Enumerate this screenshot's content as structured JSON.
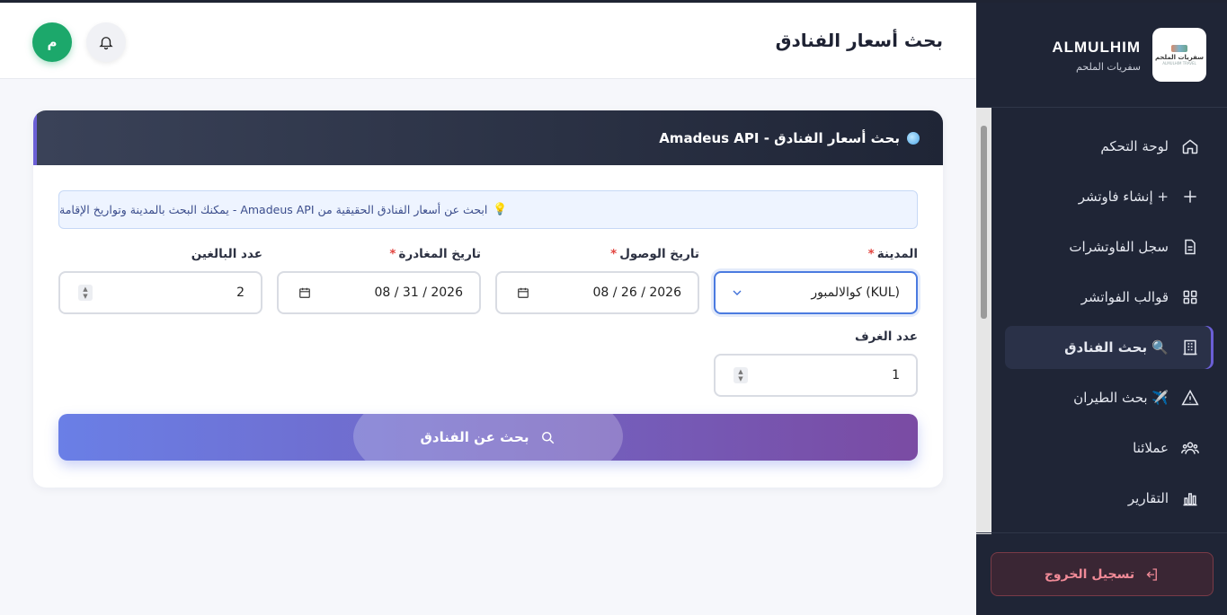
{
  "header": {
    "title": "بحث أسعار الفنادق",
    "avatar_initial": "م"
  },
  "sidebar": {
    "brand_title": "ALMULHIM",
    "brand_subtitle": "سفريات الملحم",
    "logo_text": "سفريات الملحم",
    "logo_subtext": "ALMULHIM TRAVEL",
    "items": [
      {
        "label": "لوحة التحكم",
        "icon": "home-icon"
      },
      {
        "label": "+ إنشاء فاوتشر",
        "icon": "plus-icon"
      },
      {
        "label": "سجل الفاوتشرات",
        "icon": "document-icon"
      },
      {
        "label": "قوالب الفواتشر",
        "icon": "grid-icon"
      },
      {
        "label": "🔍 بحث الفنادق",
        "icon": "building-icon",
        "active": true
      },
      {
        "label": "✈️ بحث الطيران",
        "icon": "warning-triangle-icon"
      },
      {
        "label": "عملائنا",
        "icon": "users-icon"
      },
      {
        "label": "التقارير",
        "icon": "bar-chart-icon"
      }
    ],
    "logout_label": "تسجيل الخروج"
  },
  "card": {
    "title": "بحث أسعار الفنادق - Amadeus API",
    "hint": "ابحث عن أسعار الفنادق الحقيقية من Amadeus API - يمكنك البحث بالمدينة وتواريخ الإقامة",
    "fields": {
      "city": {
        "label": "المدينة",
        "required": "*",
        "value": "كوالالمبور (KUL)"
      },
      "arrival": {
        "label": "تاريخ الوصول",
        "required": "*",
        "value": "08 / 26 / 2026"
      },
      "departure": {
        "label": "تاريخ المغادرة",
        "required": "*",
        "value": "08 / 31 / 2026"
      },
      "adults": {
        "label": "عدد البالغين",
        "value": "2"
      },
      "rooms": {
        "label": "عدد الغرف",
        "value": "1"
      }
    },
    "search_button": "بحث عن الفنادق"
  },
  "colors": {
    "sidebar_bg": "#1f2536",
    "accent": "#6b5fd6",
    "avatar_green": "#1ca86b",
    "button_gradient_start": "#6a7fe6",
    "button_gradient_end": "#7a4ba3",
    "logout_red": "#f08a97"
  }
}
